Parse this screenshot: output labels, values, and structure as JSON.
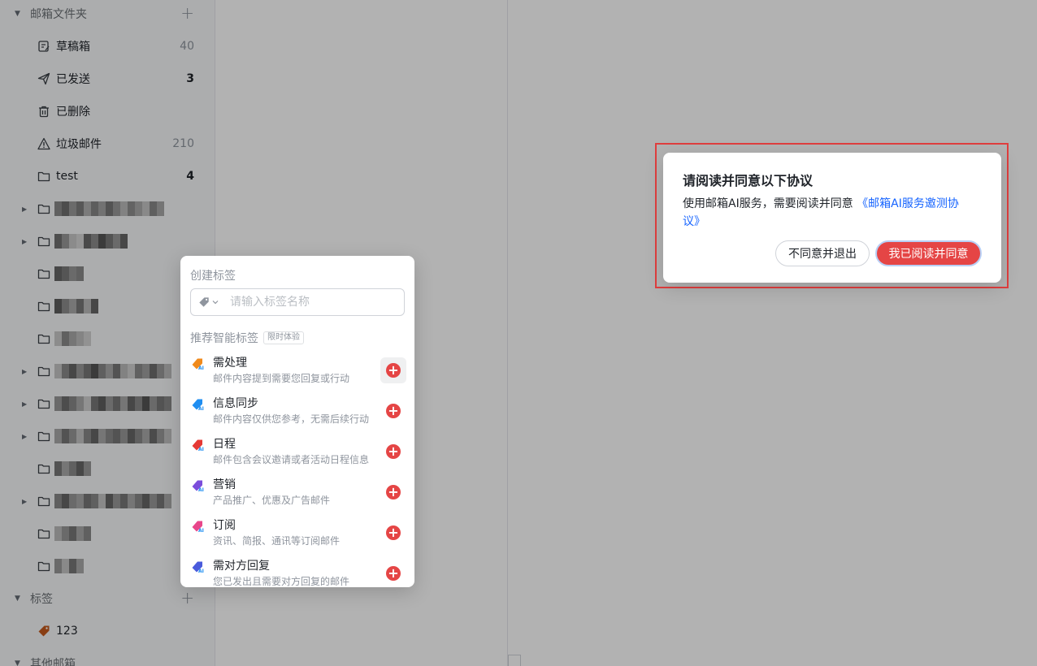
{
  "sidebar": {
    "folders_section": {
      "title": "邮箱文件夹"
    },
    "folders": [
      {
        "name": "草稿箱",
        "count": "40",
        "icon": "draft-icon"
      },
      {
        "name": "已发送",
        "count": "3",
        "icon": "send-icon"
      },
      {
        "name": "已删除",
        "count": "",
        "icon": "trash-icon"
      },
      {
        "name": "垃圾邮件",
        "count": "210",
        "icon": "warning-icon"
      },
      {
        "name": "test",
        "count": "4",
        "icon": "folder-icon"
      }
    ],
    "tags_section": {
      "title": "标签"
    },
    "tags": [
      {
        "name": "123",
        "color": "#c45a1d"
      }
    ],
    "other_section": {
      "title": "其他邮箱"
    }
  },
  "tag_popover": {
    "title": "创建标签",
    "input_placeholder": "请输入标签名称",
    "recommend_title": "推荐智能标签",
    "recommend_badge": "限时体验",
    "items": [
      {
        "name": "需处理",
        "desc": "邮件内容提到需要您回复或行动",
        "color": "#f08a1c"
      },
      {
        "name": "信息同步",
        "desc": "邮件内容仅供您参考，无需后续行动",
        "color": "#1f8ef1"
      },
      {
        "name": "日程",
        "desc": "邮件包含会议邀请或者活动日程信息",
        "color": "#e53935"
      },
      {
        "name": "营销",
        "desc": "产品推广、优惠及广告邮件",
        "color": "#7b4ddb"
      },
      {
        "name": "订阅",
        "desc": "资讯、简报、通讯等订阅邮件",
        "color": "#e8468a"
      },
      {
        "name": "需对方回复",
        "desc": "您已发出且需要对方回复的邮件",
        "color": "#4a5bdc"
      }
    ]
  },
  "dialog": {
    "title": "请阅读并同意以下协议",
    "body": "使用邮箱AI服务，需要阅读并同意",
    "link": "《邮箱AI服务邀测协议》",
    "cancel_label": "不同意并退出",
    "ok_label": "我已阅读并同意"
  },
  "colors": {
    "accent": "#e54545",
    "link": "#1664ff"
  }
}
